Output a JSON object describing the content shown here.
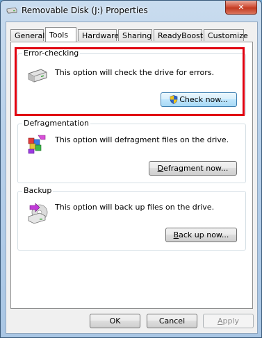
{
  "window": {
    "title": "Removable Disk (J:) Properties",
    "close_glyph": "✕"
  },
  "tabs": [
    {
      "label": "General",
      "active": false
    },
    {
      "label": "Tools",
      "active": true
    },
    {
      "label": "Hardware",
      "active": false
    },
    {
      "label": "Sharing",
      "active": false
    },
    {
      "label": "ReadyBoost",
      "active": false
    },
    {
      "label": "Customize",
      "active": false
    }
  ],
  "error_checking": {
    "title": "Error-checking",
    "description": "This option will check the drive for errors.",
    "button": "Check now...",
    "icon": "drive-icon",
    "highlight_color": "#e0000f"
  },
  "defragmentation": {
    "title": "Defragmentation",
    "description": "This option will defragment files on the drive.",
    "button_accel": "D",
    "button_rest": "efragment now...",
    "icon": "defragment-icon"
  },
  "backup": {
    "title": "Backup",
    "description": "This option will back up files on the drive.",
    "button_accel": "B",
    "button_rest": "ack up now...",
    "icon": "backup-icon"
  },
  "footer": {
    "ok": "OK",
    "cancel": "Cancel",
    "apply_accel": "A",
    "apply_rest": "pply"
  }
}
